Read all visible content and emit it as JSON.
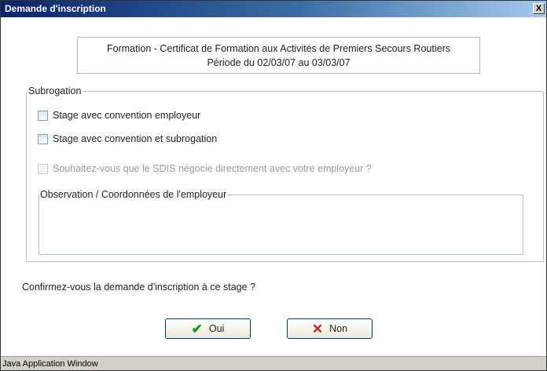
{
  "window": {
    "title": "Demande d'inscription",
    "close_glyph": "X",
    "status_text": "Java Application Window"
  },
  "info": {
    "line1": "Formation - Certificat de Formation aux Activités de Premiers Secours Routiers",
    "line2": "Période du 02/03/07 au 03/03/07"
  },
  "subrogation": {
    "legend": "Subrogation",
    "options": [
      {
        "label": "Stage avec convention employeur",
        "checked": false,
        "enabled": true
      },
      {
        "label": "Stage avec convention et subrogation",
        "checked": false,
        "enabled": true
      },
      {
        "label": "Souhaitez-vous que le SDIS négocie directement avec votre employeur ?",
        "checked": false,
        "enabled": false
      }
    ],
    "observation_legend": "Observation / Coordonnées de l'employeur",
    "observation_value": ""
  },
  "confirm_text": "Confirmez-vous la demande d'inscription à ce stage ?",
  "buttons": {
    "yes": {
      "label": "Oui",
      "icon": "check-icon",
      "icon_color": "#1f9a1f"
    },
    "no": {
      "label": "Non",
      "icon": "x-icon",
      "icon_color": "#d61b1b"
    }
  },
  "colors": {
    "titlebar_start": "#0a246a",
    "titlebar_end": "#a6caf0",
    "frame_border": "#b4c4d6"
  }
}
